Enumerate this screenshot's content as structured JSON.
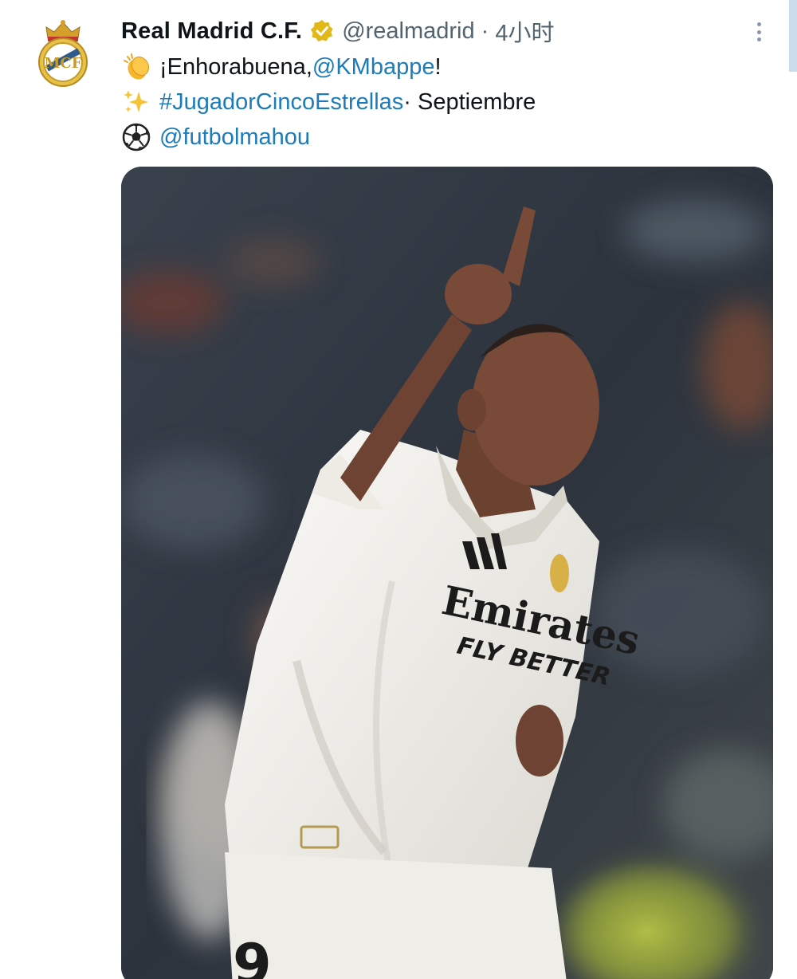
{
  "post": {
    "display_name": "Real Madrid C.F.",
    "handle": "@realmadrid",
    "separator": "·",
    "time": "4小时",
    "lines": [
      {
        "icon": "clapping-hands-icon",
        "prefix": "¡Enhorabuena, ",
        "mention": "@KMbappe",
        "suffix": "!"
      },
      {
        "icon": "sparkles-icon",
        "hashtag": "#JugadorCincoEstrellas",
        "suffix": " · Septiembre"
      },
      {
        "icon": "soccer-ball-icon",
        "mention": "@futbolmahou"
      }
    ],
    "jersey": {
      "sponsor_line1": "Emirates",
      "sponsor_line2": "FLY BETTER"
    }
  },
  "colors": {
    "link": "#1d7bb8",
    "muted": "#536471",
    "verified": "#e2b719",
    "kit": "#f1efea"
  }
}
